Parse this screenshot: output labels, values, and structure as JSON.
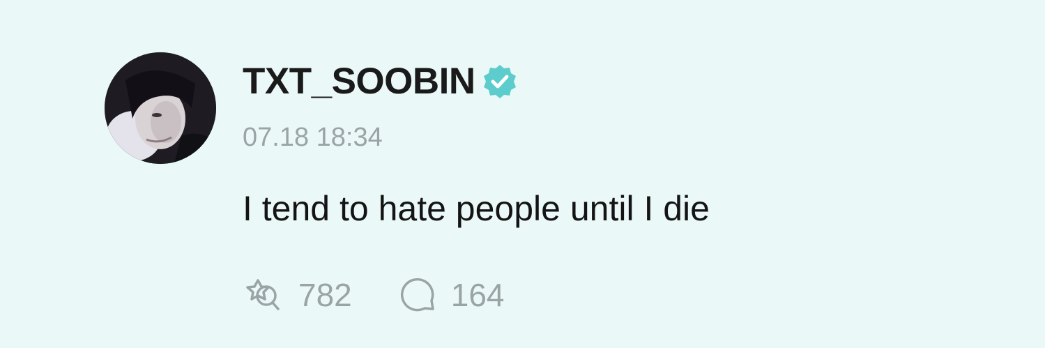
{
  "post": {
    "author": {
      "username": "TXT_SOOBIN",
      "verified": true,
      "avatar_icon": "profile-photo"
    },
    "timestamp": "07.18 18:34",
    "content": "I tend to hate people until I die",
    "stats": {
      "reposts": "782",
      "comments": "164",
      "repost_icon": "repost-icon",
      "comment_icon": "comment-bubble-icon"
    }
  },
  "colors": {
    "background": "#eaf9f7",
    "verified_badge": "#5dcccc",
    "muted_text": "#9aa3a6",
    "primary_text": "#141414"
  }
}
